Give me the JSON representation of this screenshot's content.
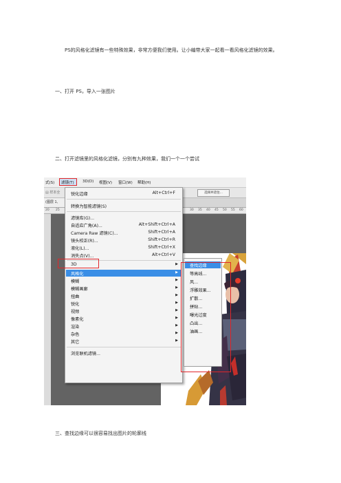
{
  "article": {
    "intro": "PS的风格化滤镜有一些特殊效果，非常方便我们使用。让小编带大家一起看一看风格化滤镜的效果。",
    "step1": "一、打开 PS，导入一张图片",
    "step2": "二、打开滤镜里的风格化滤镜，分别有九种效果，我们一个一个尝试",
    "step3": "三、查找边缘可以很容易找出图片的轮廓线"
  },
  "screenshot": {
    "menubar": [
      "式(S)",
      "滤镜(T)",
      "3D(D)",
      "视图(V)",
      "窗口(W)",
      "帮助(H)"
    ],
    "optbar_left": "▤ 样本全",
    "optbar_right": "选择并遮住...",
    "tab_label": "(图层 1,",
    "ruler_ticks": [
      "20",
      "25",
      "30",
      "35",
      "40",
      "45",
      "50",
      "55",
      "60"
    ],
    "colors": {
      "highlight": "#3a8ee6",
      "annotation_red": "#e0262a"
    },
    "menu": {
      "top_items": [
        {
          "label": "锐化边缘",
          "shortcut": "Alt+Ctrl+F"
        },
        {
          "label": "转换为智能滤镜(S)",
          "shortcut": ""
        }
      ],
      "mid_items": [
        {
          "label": "滤镜库(G)...",
          "shortcut": ""
        },
        {
          "label": "自适应广角(A)...",
          "shortcut": "Alt+Shift+Ctrl+A"
        },
        {
          "label": "Camera Raw 滤镜(C)...",
          "shortcut": "Shift+Ctrl+A"
        },
        {
          "label": "镜头校正(R)...",
          "shortcut": "Shift+Ctrl+R"
        },
        {
          "label": "液化(L)...",
          "shortcut": "Shift+Ctrl+X"
        },
        {
          "label": "消失点(V)...",
          "shortcut": "Alt+Ctrl+V"
        }
      ],
      "sub_items": [
        "3D",
        "风格化",
        "模糊",
        "模糊画廊",
        "扭曲",
        "锐化",
        "视频",
        "像素化",
        "渲染",
        "杂色",
        "其它"
      ],
      "browse": "浏览联机滤镜..."
    },
    "submenu": [
      "查找边缘",
      "等高线...",
      "风...",
      "浮雕效果...",
      "扩散...",
      "拼贴...",
      "曝光过度",
      "凸出...",
      "油画..."
    ]
  }
}
